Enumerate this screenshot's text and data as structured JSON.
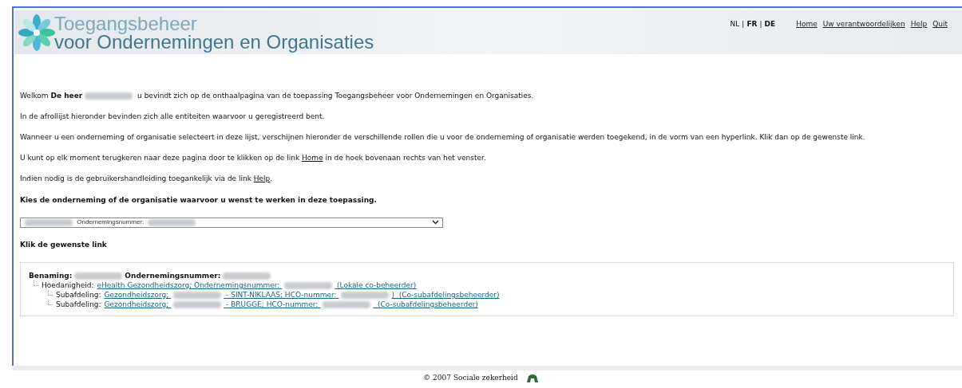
{
  "header": {
    "title_line_1": "Toegangsbeheer",
    "title_line_2": "voor Ondernemingen en Organisaties",
    "languages": [
      {
        "label": "NL",
        "selected": true
      },
      {
        "label": "FR",
        "selected": false
      },
      {
        "label": "DE",
        "selected": false
      }
    ],
    "separator": "|",
    "nav": [
      "Home",
      "Uw verantwoordelijken",
      "Help",
      "Quit"
    ]
  },
  "intro": [
    {
      "parts": [
        {
          "kind": "text",
          "text": "Welkom "
        },
        {
          "kind": "bold",
          "text": "De heer"
        },
        {
          "kind": "redacted"
        },
        {
          "kind": "text",
          "text": " u bevindt zich op de onthaalpagina van de toepassing Toegangsbeheer voor Ondernemingen en Organisaties."
        }
      ]
    },
    {
      "parts": [
        {
          "kind": "text",
          "text": "In de afrollijst hieronder bevinden zich alle entiteiten waarvoor u geregistreerd bent."
        }
      ]
    },
    {
      "parts": [
        {
          "kind": "text",
          "text": "Wanneer u een onderneming of organisatie selecteert in deze lijst, verschijnen hieronder de verschillende rollen die u voor de onderneming of organisatie werden toegekend, in de vorm van een hyperlink. Klik dan op de gewenste link."
        }
      ]
    },
    {
      "parts": [
        {
          "kind": "text",
          "text": "U kunt op elk moment terugkeren naar deze pagina door te klikken op de link "
        },
        {
          "kind": "link",
          "text": "Home"
        },
        {
          "kind": "text",
          "text": " in de hoek bovenaan rechts van het venster."
        }
      ]
    },
    {
      "parts": [
        {
          "kind": "text",
          "text": "Indien nodig is de gebruikershandleiding toegankelijk via de link "
        },
        {
          "kind": "link",
          "text": "Help"
        },
        {
          "kind": "text",
          "text": "."
        }
      ]
    }
  ],
  "choose_heading": "Kies de onderneming of de organisatie waarvoor u wenst te werken in deze toepassing.",
  "select": {
    "value_parts": [
      {
        "kind": "redacted"
      },
      {
        "kind": "text",
        "text": " Ondernemingsnummer: "
      },
      {
        "kind": "redacted"
      }
    ]
  },
  "links_heading": "Klik de gewenste link",
  "tree": {
    "label_1": "Benaming:",
    "label_2": "Ondernemingsnummer:",
    "children": [
      {
        "label": "Hoedanigheid:",
        "link_parts": [
          {
            "kind": "text",
            "text": "eHealth Gezondheidszorg; Ondernemingsnummer: "
          },
          {
            "kind": "redacted"
          },
          {
            "kind": "text",
            "text": " (Lokale co-beheerder)"
          }
        ],
        "children": [
          {
            "label": "Subafdeling:",
            "link_parts": [
              {
                "kind": "text",
                "text": "Gezondheidszorg; "
              },
              {
                "kind": "redacted"
              },
              {
                "kind": "text",
                "text": " - SINT-NIKLAAS; HCO-nummer: "
              },
              {
                "kind": "redacted"
              },
              {
                "kind": "text",
                "text": ")  (Co-subafdelingsbeheerder)"
              }
            ]
          },
          {
            "label": "Subafdeling:",
            "link_parts": [
              {
                "kind": "text",
                "text": "Gezondheidszorg; "
              },
              {
                "kind": "redacted"
              },
              {
                "kind": "text",
                "text": " - BRUGGE; HCO-nummer: "
              },
              {
                "kind": "redacted"
              },
              {
                "kind": "text",
                "text": "  (Co-subafdelingsbeheerder)"
              }
            ]
          }
        ]
      }
    ]
  },
  "footer": {
    "text": "© 2007 Sociale zekerheid"
  }
}
